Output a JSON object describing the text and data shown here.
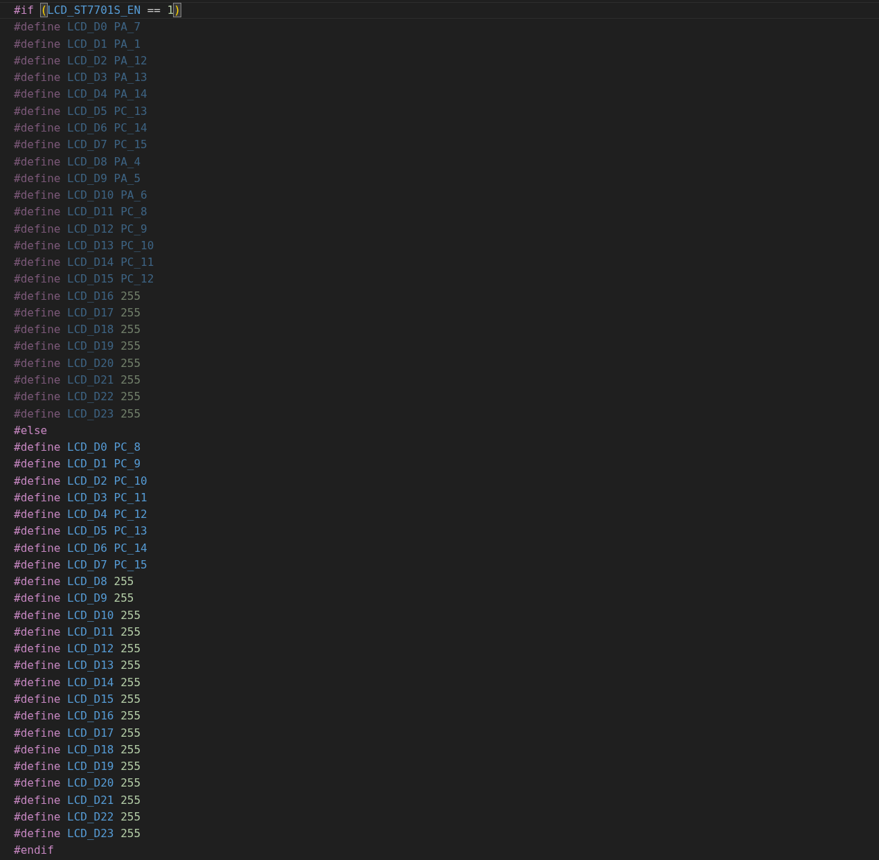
{
  "editor": {
    "lines": [
      {
        "current": true,
        "inactive": false,
        "tokens": [
          {
            "kind": "directive",
            "text": "#if "
          },
          {
            "kind": "bracket",
            "text": "(",
            "matched": true
          },
          {
            "kind": "macro",
            "text": "LCD_ST7701S_EN"
          },
          {
            "kind": "operator",
            "text": " == "
          },
          {
            "kind": "number",
            "text": "1"
          },
          {
            "kind": "bracket",
            "text": ")",
            "matched": true
          }
        ]
      },
      {
        "current": false,
        "inactive": true,
        "tokens": [
          {
            "kind": "directive",
            "text": "#define "
          },
          {
            "kind": "macro",
            "text": "LCD_D0 PA_7"
          }
        ]
      },
      {
        "current": false,
        "inactive": true,
        "tokens": [
          {
            "kind": "directive",
            "text": "#define "
          },
          {
            "kind": "macro",
            "text": "LCD_D1 PA_1"
          }
        ]
      },
      {
        "current": false,
        "inactive": true,
        "tokens": [
          {
            "kind": "directive",
            "text": "#define "
          },
          {
            "kind": "macro",
            "text": "LCD_D2 PA_12"
          }
        ]
      },
      {
        "current": false,
        "inactive": true,
        "tokens": [
          {
            "kind": "directive",
            "text": "#define "
          },
          {
            "kind": "macro",
            "text": "LCD_D3 PA_13"
          }
        ]
      },
      {
        "current": false,
        "inactive": true,
        "tokens": [
          {
            "kind": "directive",
            "text": "#define "
          },
          {
            "kind": "macro",
            "text": "LCD_D4 PA_14"
          }
        ]
      },
      {
        "current": false,
        "inactive": true,
        "tokens": [
          {
            "kind": "directive",
            "text": "#define "
          },
          {
            "kind": "macro",
            "text": "LCD_D5 PC_13"
          }
        ]
      },
      {
        "current": false,
        "inactive": true,
        "tokens": [
          {
            "kind": "directive",
            "text": "#define "
          },
          {
            "kind": "macro",
            "text": "LCD_D6 PC_14"
          }
        ]
      },
      {
        "current": false,
        "inactive": true,
        "tokens": [
          {
            "kind": "directive",
            "text": "#define "
          },
          {
            "kind": "macro",
            "text": "LCD_D7 PC_15"
          }
        ]
      },
      {
        "current": false,
        "inactive": true,
        "tokens": [
          {
            "kind": "directive",
            "text": "#define "
          },
          {
            "kind": "macro",
            "text": "LCD_D8 PA_4"
          }
        ]
      },
      {
        "current": false,
        "inactive": true,
        "tokens": [
          {
            "kind": "directive",
            "text": "#define "
          },
          {
            "kind": "macro",
            "text": "LCD_D9 PA_5"
          }
        ]
      },
      {
        "current": false,
        "inactive": true,
        "tokens": [
          {
            "kind": "directive",
            "text": "#define "
          },
          {
            "kind": "macro",
            "text": "LCD_D10 PA_6"
          }
        ]
      },
      {
        "current": false,
        "inactive": true,
        "tokens": [
          {
            "kind": "directive",
            "text": "#define "
          },
          {
            "kind": "macro",
            "text": "LCD_D11 PC_8"
          }
        ]
      },
      {
        "current": false,
        "inactive": true,
        "tokens": [
          {
            "kind": "directive",
            "text": "#define "
          },
          {
            "kind": "macro",
            "text": "LCD_D12 PC_9"
          }
        ]
      },
      {
        "current": false,
        "inactive": true,
        "tokens": [
          {
            "kind": "directive",
            "text": "#define "
          },
          {
            "kind": "macro",
            "text": "LCD_D13 PC_10"
          }
        ]
      },
      {
        "current": false,
        "inactive": true,
        "tokens": [
          {
            "kind": "directive",
            "text": "#define "
          },
          {
            "kind": "macro",
            "text": "LCD_D14 PC_11"
          }
        ]
      },
      {
        "current": false,
        "inactive": true,
        "tokens": [
          {
            "kind": "directive",
            "text": "#define "
          },
          {
            "kind": "macro",
            "text": "LCD_D15 PC_12"
          }
        ]
      },
      {
        "current": false,
        "inactive": true,
        "tokens": [
          {
            "kind": "directive",
            "text": "#define "
          },
          {
            "kind": "macro",
            "text": "LCD_D16 "
          },
          {
            "kind": "number",
            "text": "255"
          }
        ]
      },
      {
        "current": false,
        "inactive": true,
        "tokens": [
          {
            "kind": "directive",
            "text": "#define "
          },
          {
            "kind": "macro",
            "text": "LCD_D17 "
          },
          {
            "kind": "number",
            "text": "255"
          }
        ]
      },
      {
        "current": false,
        "inactive": true,
        "tokens": [
          {
            "kind": "directive",
            "text": "#define "
          },
          {
            "kind": "macro",
            "text": "LCD_D18 "
          },
          {
            "kind": "number",
            "text": "255"
          }
        ]
      },
      {
        "current": false,
        "inactive": true,
        "tokens": [
          {
            "kind": "directive",
            "text": "#define "
          },
          {
            "kind": "macro",
            "text": "LCD_D19 "
          },
          {
            "kind": "number",
            "text": "255"
          }
        ]
      },
      {
        "current": false,
        "inactive": true,
        "tokens": [
          {
            "kind": "directive",
            "text": "#define "
          },
          {
            "kind": "macro",
            "text": "LCD_D20 "
          },
          {
            "kind": "number",
            "text": "255"
          }
        ]
      },
      {
        "current": false,
        "inactive": true,
        "tokens": [
          {
            "kind": "directive",
            "text": "#define "
          },
          {
            "kind": "macro",
            "text": "LCD_D21 "
          },
          {
            "kind": "number",
            "text": "255"
          }
        ]
      },
      {
        "current": false,
        "inactive": true,
        "tokens": [
          {
            "kind": "directive",
            "text": "#define "
          },
          {
            "kind": "macro",
            "text": "LCD_D22 "
          },
          {
            "kind": "number",
            "text": "255"
          }
        ]
      },
      {
        "current": false,
        "inactive": true,
        "tokens": [
          {
            "kind": "directive",
            "text": "#define "
          },
          {
            "kind": "macro",
            "text": "LCD_D23 "
          },
          {
            "kind": "number",
            "text": "255"
          }
        ]
      },
      {
        "current": false,
        "inactive": false,
        "tokens": [
          {
            "kind": "directive",
            "text": "#else"
          }
        ]
      },
      {
        "current": false,
        "inactive": false,
        "tokens": [
          {
            "kind": "directive",
            "text": "#define "
          },
          {
            "kind": "macro",
            "text": "LCD_D0 PC_8"
          }
        ]
      },
      {
        "current": false,
        "inactive": false,
        "tokens": [
          {
            "kind": "directive",
            "text": "#define "
          },
          {
            "kind": "macro",
            "text": "LCD_D1 PC_9"
          }
        ]
      },
      {
        "current": false,
        "inactive": false,
        "tokens": [
          {
            "kind": "directive",
            "text": "#define "
          },
          {
            "kind": "macro",
            "text": "LCD_D2 PC_10"
          }
        ]
      },
      {
        "current": false,
        "inactive": false,
        "tokens": [
          {
            "kind": "directive",
            "text": "#define "
          },
          {
            "kind": "macro",
            "text": "LCD_D3 PC_11"
          }
        ]
      },
      {
        "current": false,
        "inactive": false,
        "tokens": [
          {
            "kind": "directive",
            "text": "#define "
          },
          {
            "kind": "macro",
            "text": "LCD_D4 PC_12"
          }
        ]
      },
      {
        "current": false,
        "inactive": false,
        "tokens": [
          {
            "kind": "directive",
            "text": "#define "
          },
          {
            "kind": "macro",
            "text": "LCD_D5 PC_13"
          }
        ]
      },
      {
        "current": false,
        "inactive": false,
        "tokens": [
          {
            "kind": "directive",
            "text": "#define "
          },
          {
            "kind": "macro",
            "text": "LCD_D6 PC_14"
          }
        ]
      },
      {
        "current": false,
        "inactive": false,
        "tokens": [
          {
            "kind": "directive",
            "text": "#define "
          },
          {
            "kind": "macro",
            "text": "LCD_D7 PC_15"
          }
        ]
      },
      {
        "current": false,
        "inactive": false,
        "tokens": [
          {
            "kind": "directive",
            "text": "#define "
          },
          {
            "kind": "macro",
            "text": "LCD_D8 "
          },
          {
            "kind": "number",
            "text": "255"
          }
        ]
      },
      {
        "current": false,
        "inactive": false,
        "tokens": [
          {
            "kind": "directive",
            "text": "#define "
          },
          {
            "kind": "macro",
            "text": "LCD_D9 "
          },
          {
            "kind": "number",
            "text": "255"
          }
        ]
      },
      {
        "current": false,
        "inactive": false,
        "tokens": [
          {
            "kind": "directive",
            "text": "#define "
          },
          {
            "kind": "macro",
            "text": "LCD_D10 "
          },
          {
            "kind": "number",
            "text": "255"
          }
        ]
      },
      {
        "current": false,
        "inactive": false,
        "tokens": [
          {
            "kind": "directive",
            "text": "#define "
          },
          {
            "kind": "macro",
            "text": "LCD_D11 "
          },
          {
            "kind": "number",
            "text": "255"
          }
        ]
      },
      {
        "current": false,
        "inactive": false,
        "tokens": [
          {
            "kind": "directive",
            "text": "#define "
          },
          {
            "kind": "macro",
            "text": "LCD_D12 "
          },
          {
            "kind": "number",
            "text": "255"
          }
        ]
      },
      {
        "current": false,
        "inactive": false,
        "tokens": [
          {
            "kind": "directive",
            "text": "#define "
          },
          {
            "kind": "macro",
            "text": "LCD_D13 "
          },
          {
            "kind": "number",
            "text": "255"
          }
        ]
      },
      {
        "current": false,
        "inactive": false,
        "tokens": [
          {
            "kind": "directive",
            "text": "#define "
          },
          {
            "kind": "macro",
            "text": "LCD_D14 "
          },
          {
            "kind": "number",
            "text": "255"
          }
        ]
      },
      {
        "current": false,
        "inactive": false,
        "tokens": [
          {
            "kind": "directive",
            "text": "#define "
          },
          {
            "kind": "macro",
            "text": "LCD_D15 "
          },
          {
            "kind": "number",
            "text": "255"
          }
        ]
      },
      {
        "current": false,
        "inactive": false,
        "tokens": [
          {
            "kind": "directive",
            "text": "#define "
          },
          {
            "kind": "macro",
            "text": "LCD_D16 "
          },
          {
            "kind": "number",
            "text": "255"
          }
        ]
      },
      {
        "current": false,
        "inactive": false,
        "tokens": [
          {
            "kind": "directive",
            "text": "#define "
          },
          {
            "kind": "macro",
            "text": "LCD_D17 "
          },
          {
            "kind": "number",
            "text": "255"
          }
        ]
      },
      {
        "current": false,
        "inactive": false,
        "tokens": [
          {
            "kind": "directive",
            "text": "#define "
          },
          {
            "kind": "macro",
            "text": "LCD_D18 "
          },
          {
            "kind": "number",
            "text": "255"
          }
        ]
      },
      {
        "current": false,
        "inactive": false,
        "tokens": [
          {
            "kind": "directive",
            "text": "#define "
          },
          {
            "kind": "macro",
            "text": "LCD_D19 "
          },
          {
            "kind": "number",
            "text": "255"
          }
        ]
      },
      {
        "current": false,
        "inactive": false,
        "tokens": [
          {
            "kind": "directive",
            "text": "#define "
          },
          {
            "kind": "macro",
            "text": "LCD_D20 "
          },
          {
            "kind": "number",
            "text": "255"
          }
        ]
      },
      {
        "current": false,
        "inactive": false,
        "tokens": [
          {
            "kind": "directive",
            "text": "#define "
          },
          {
            "kind": "macro",
            "text": "LCD_D21 "
          },
          {
            "kind": "number",
            "text": "255"
          }
        ]
      },
      {
        "current": false,
        "inactive": false,
        "tokens": [
          {
            "kind": "directive",
            "text": "#define "
          },
          {
            "kind": "macro",
            "text": "LCD_D22 "
          },
          {
            "kind": "number",
            "text": "255"
          }
        ]
      },
      {
        "current": false,
        "inactive": false,
        "tokens": [
          {
            "kind": "directive",
            "text": "#define "
          },
          {
            "kind": "macro",
            "text": "LCD_D23 "
          },
          {
            "kind": "number",
            "text": "255"
          }
        ]
      },
      {
        "current": false,
        "inactive": false,
        "tokens": [
          {
            "kind": "directive",
            "text": "#endif"
          }
        ]
      }
    ]
  }
}
